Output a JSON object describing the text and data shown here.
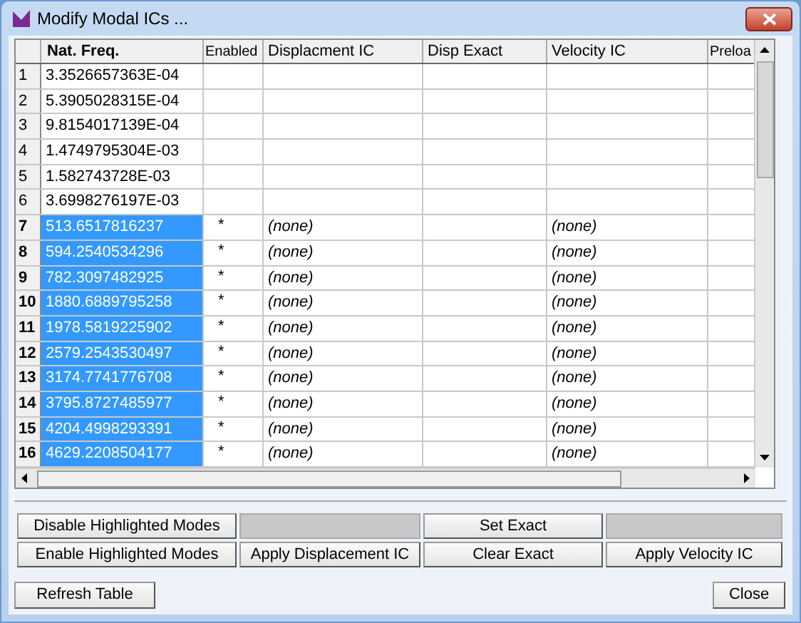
{
  "window": {
    "title": "Modify Modal ICs ..."
  },
  "table": {
    "columns": [
      "Nat. Freq.",
      "Enabled",
      "Displacment IC",
      "Disp Exact",
      "Velocity IC",
      "Preloa"
    ],
    "rows": [
      {
        "index": "1",
        "freq": "3.3526657363E-04",
        "selected": false
      },
      {
        "index": "2",
        "freq": "5.3905028315E-04",
        "selected": false
      },
      {
        "index": "3",
        "freq": "9.8154017139E-04",
        "selected": false
      },
      {
        "index": "4",
        "freq": "1.4749795304E-03",
        "selected": false
      },
      {
        "index": "5",
        "freq": "1.582743728E-03",
        "selected": false
      },
      {
        "index": "6",
        "freq": "3.6998276197E-03",
        "selected": false
      },
      {
        "index": "7",
        "freq": "513.6517816237",
        "enabled": "*",
        "displacement": "(none)",
        "velocity": "(none)",
        "selected": true
      },
      {
        "index": "8",
        "freq": "594.2540534296",
        "enabled": "*",
        "displacement": "(none)",
        "velocity": "(none)",
        "selected": true
      },
      {
        "index": "9",
        "freq": "782.3097482925",
        "enabled": "*",
        "displacement": "(none)",
        "velocity": "(none)",
        "selected": true
      },
      {
        "index": "10",
        "freq": "1880.6889795258",
        "enabled": "*",
        "displacement": "(none)",
        "velocity": "(none)",
        "selected": true
      },
      {
        "index": "11",
        "freq": "1978.5819225902",
        "enabled": "*",
        "displacement": "(none)",
        "velocity": "(none)",
        "selected": true
      },
      {
        "index": "12",
        "freq": "2579.2543530497",
        "enabled": "*",
        "displacement": "(none)",
        "velocity": "(none)",
        "selected": true
      },
      {
        "index": "13",
        "freq": "3174.7741776708",
        "enabled": "*",
        "displacement": "(none)",
        "velocity": "(none)",
        "selected": true
      },
      {
        "index": "14",
        "freq": "3795.8727485977",
        "enabled": "*",
        "displacement": "(none)",
        "velocity": "(none)",
        "selected": true
      },
      {
        "index": "15",
        "freq": "4204.4998293391",
        "enabled": "*",
        "displacement": "(none)",
        "velocity": "(none)",
        "selected": true
      },
      {
        "index": "16",
        "freq": "4629.2208504177",
        "enabled": "*",
        "displacement": "(none)",
        "velocity": "(none)",
        "selected": true
      }
    ]
  },
  "action_grid": [
    {
      "kind": "button",
      "label": "Disable Highlighted Modes"
    },
    {
      "kind": "blank"
    },
    {
      "kind": "button",
      "label": "Set Exact"
    },
    {
      "kind": "blank"
    },
    {
      "kind": "button",
      "label": "Enable Highlighted Modes"
    },
    {
      "kind": "button",
      "label": "Apply Displacement IC"
    },
    {
      "kind": "button",
      "label": "Clear Exact"
    },
    {
      "kind": "button",
      "label": "Apply Velocity IC"
    }
  ],
  "footer_buttons": [
    "Refresh Table",
    "Close"
  ]
}
